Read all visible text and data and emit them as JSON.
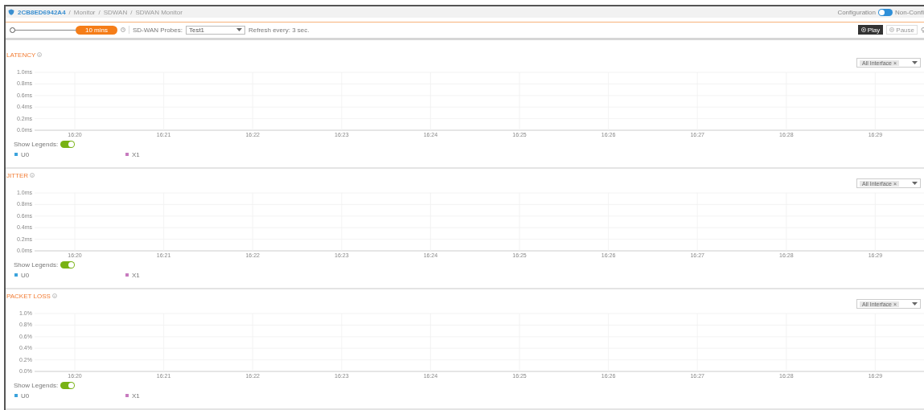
{
  "breadcrumb": {
    "device": "2CB8ED6942A4",
    "separator": "/",
    "path": [
      "Monitor",
      "SDWAN",
      "SDWAN Monitor"
    ]
  },
  "mode_switch": {
    "left_label": "Configuration",
    "right_label": "Non-Confi",
    "on": false
  },
  "toolbar": {
    "time_slider": {
      "level": 0
    },
    "range": "10 mins",
    "probes_label": "SD-WAN Probes:",
    "probe": "Test1",
    "refresh": "Refresh every: 3 sec.",
    "playback": [
      {
        "label": "Play",
        "selected": true
      },
      {
        "label": "Pause",
        "selected": false
      }
    ]
  },
  "panels": [
    {
      "title": "LATENCY",
      "filter": "All Interface",
      "filter_remove": "×",
      "show_legends_label": "Show Legends:",
      "show_legends": true,
      "chart_data": {
        "type": "line",
        "grid": true,
        "categories": [
          "16:20",
          "16:21",
          "16:22",
          "16:23",
          "16:24",
          "16:25",
          "16:26",
          "16:27",
          "16:28",
          "16:29"
        ],
        "ylim": [
          0,
          1
        ],
        "yticks": [
          {
            "value": 0,
            "label": "0.0ms"
          },
          {
            "value": 0.2,
            "label": "0.2ms"
          },
          {
            "value": 0.4,
            "label": "0.4ms"
          },
          {
            "value": 0.6,
            "label": "0.6ms"
          },
          {
            "value": 0.8,
            "label": "0.8ms"
          },
          {
            "value": 1,
            "label": "1.0ms"
          }
        ],
        "series": [
          {
            "name": "U0",
            "color": "#3ba3dc",
            "values": [
              null,
              null,
              null,
              null,
              null,
              null,
              null,
              null,
              null,
              null
            ]
          },
          {
            "name": "X1",
            "color": "#c77bbf",
            "values": [
              null,
              null,
              null,
              null,
              null,
              null,
              null,
              null,
              null,
              null
            ]
          }
        ]
      }
    },
    {
      "title": "JITTER",
      "filter": "All Interface",
      "filter_remove": "×",
      "show_legends_label": "Show Legends:",
      "show_legends": true,
      "chart_data": {
        "type": "line",
        "grid": true,
        "categories": [
          "16:20",
          "16:21",
          "16:22",
          "16:23",
          "16:24",
          "16:25",
          "16:26",
          "16:27",
          "16:28",
          "16:29"
        ],
        "ylim": [
          0,
          1
        ],
        "yticks": [
          {
            "value": 0,
            "label": "0.0ms"
          },
          {
            "value": 0.2,
            "label": "0.2ms"
          },
          {
            "value": 0.4,
            "label": "0.4ms"
          },
          {
            "value": 0.6,
            "label": "0.6ms"
          },
          {
            "value": 0.8,
            "label": "0.8ms"
          },
          {
            "value": 1,
            "label": "1.0ms"
          }
        ],
        "series": [
          {
            "name": "U0",
            "color": "#3ba3dc",
            "values": [
              null,
              null,
              null,
              null,
              null,
              null,
              null,
              null,
              null,
              null
            ]
          },
          {
            "name": "X1",
            "color": "#c77bbf",
            "values": [
              null,
              null,
              null,
              null,
              null,
              null,
              null,
              null,
              null,
              null
            ]
          }
        ]
      }
    },
    {
      "title": "PACKET LOSS",
      "filter": "All Interface",
      "filter_remove": "×",
      "show_legends_label": "Show Legends:",
      "show_legends": true,
      "chart_data": {
        "type": "line",
        "grid": true,
        "categories": [
          "16:20",
          "16:21",
          "16:22",
          "16:23",
          "16:24",
          "16:25",
          "16:26",
          "16:27",
          "16:28",
          "16:29"
        ],
        "ylim": [
          0,
          1
        ],
        "yticks": [
          {
            "value": 0,
            "label": "0.0%"
          },
          {
            "value": 0.2,
            "label": "0.2%"
          },
          {
            "value": 0.4,
            "label": "0.4%"
          },
          {
            "value": 0.6,
            "label": "0.6%"
          },
          {
            "value": 0.8,
            "label": "0.8%"
          },
          {
            "value": 1,
            "label": "1.0%"
          }
        ],
        "series": [
          {
            "name": "U0",
            "color": "#3ba3dc",
            "values": [
              null,
              null,
              null,
              null,
              null,
              null,
              null,
              null,
              null,
              null
            ]
          },
          {
            "name": "X1",
            "color": "#c77bbf",
            "values": [
              null,
              null,
              null,
              null,
              null,
              null,
              null,
              null,
              null,
              null
            ]
          }
        ]
      }
    }
  ]
}
